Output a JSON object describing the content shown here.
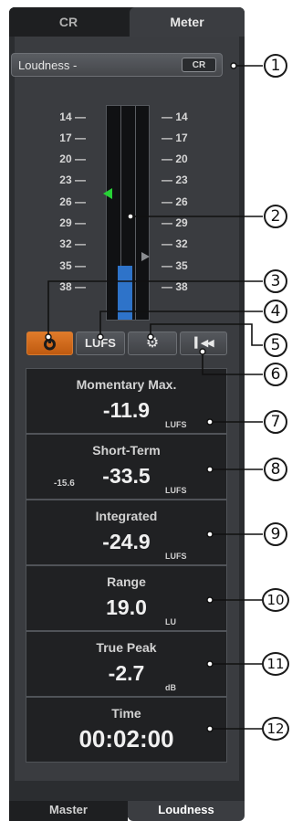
{
  "tabs": {
    "cr": "CR",
    "meter": "Meter"
  },
  "preset": {
    "label": "Loudness -",
    "cr_button": "CR"
  },
  "scale": [
    "14",
    "17",
    "20",
    "23",
    "26",
    "29",
    "32",
    "35",
    "38"
  ],
  "buttons": {
    "power_icon": "power-icon",
    "lufs": "LUFS",
    "settings_icon": "gear-icon",
    "reset_icon": "reset-icon"
  },
  "readouts": [
    {
      "label": "Momentary Max.",
      "value": "-11.9",
      "unit": "LUFS"
    },
    {
      "label": "Short-Term",
      "value": "-33.5",
      "unit": "LUFS",
      "sub": "-15.6"
    },
    {
      "label": "Integrated",
      "value": "-24.9",
      "unit": "LUFS"
    },
    {
      "label": "Range",
      "value": "19.0",
      "unit": "LU"
    },
    {
      "label": "True Peak",
      "value": "-2.7",
      "unit": "dB"
    },
    {
      "label": "Time",
      "value": "00:02:00",
      "unit": ""
    }
  ],
  "bottom_tabs": {
    "master": "Master",
    "loudness": "Loudness"
  },
  "callouts": [
    "1",
    "2",
    "3",
    "4",
    "5",
    "6",
    "7",
    "8",
    "9",
    "10",
    "11",
    "12"
  ],
  "colors": {
    "accent_orange": "#d26a1c",
    "meter_blue": "#2e73c9",
    "target_green": "#27d136"
  }
}
